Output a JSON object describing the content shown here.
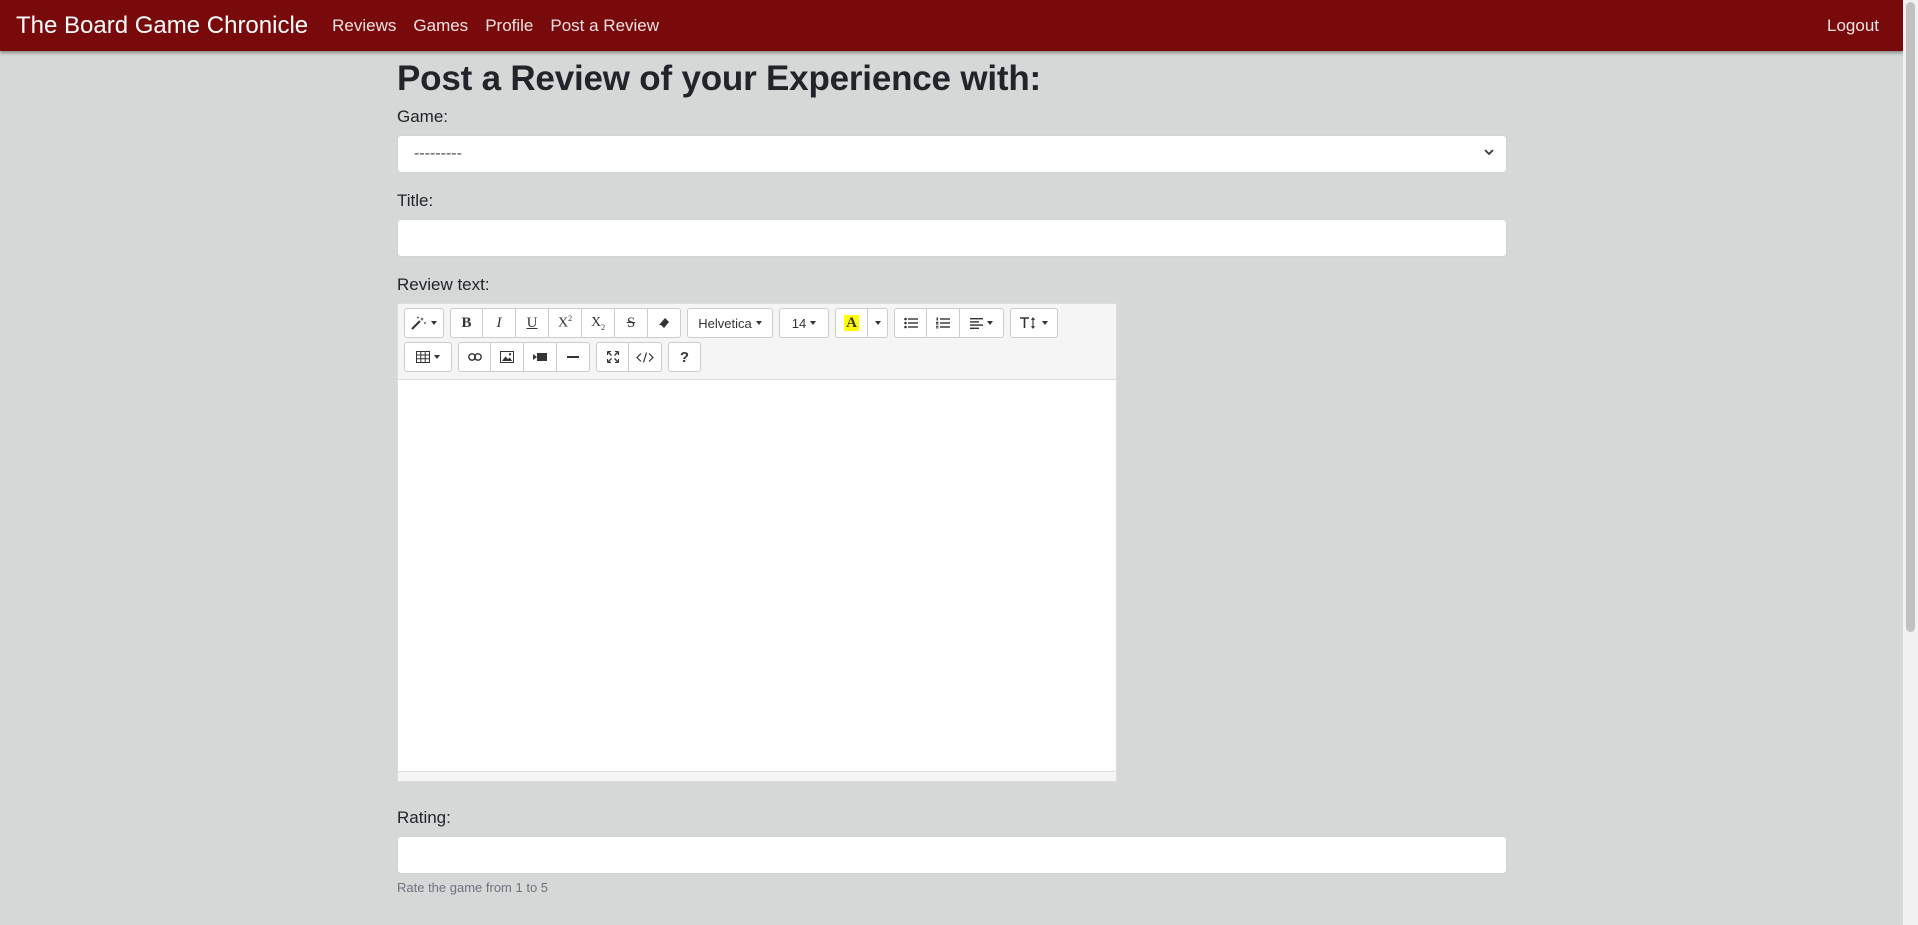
{
  "navbar": {
    "brand": "The Board Game Chronicle",
    "links": [
      "Reviews",
      "Games",
      "Profile",
      "Post a Review"
    ],
    "logout": "Logout",
    "bg_color": "#780a0c"
  },
  "page": {
    "heading": "Post a Review of your Experience with:"
  },
  "form": {
    "game_label": "Game:",
    "game_selected": "---------",
    "title_label": "Title:",
    "title_value": "",
    "review_label": "Review text:",
    "rating_label": "Rating:",
    "rating_value": "",
    "rating_help": "Rate the game from 1 to 5"
  },
  "editor": {
    "font_name": "Helvetica",
    "font_size": "14",
    "text_color_icon": "A",
    "help_icon": "?",
    "icons_row1": [
      "magic-style",
      "bold",
      "italic",
      "underline",
      "superscript",
      "subscript",
      "strikethrough",
      "eraser",
      "font-name",
      "font-size",
      "color",
      "unordered-list",
      "ordered-list",
      "paragraph-align",
      "line-height"
    ],
    "icons_row2": [
      "table",
      "link",
      "picture",
      "video",
      "horizontal-rule",
      "fullscreen",
      "code-view",
      "help"
    ],
    "highlight_color": "#ffff00"
  }
}
